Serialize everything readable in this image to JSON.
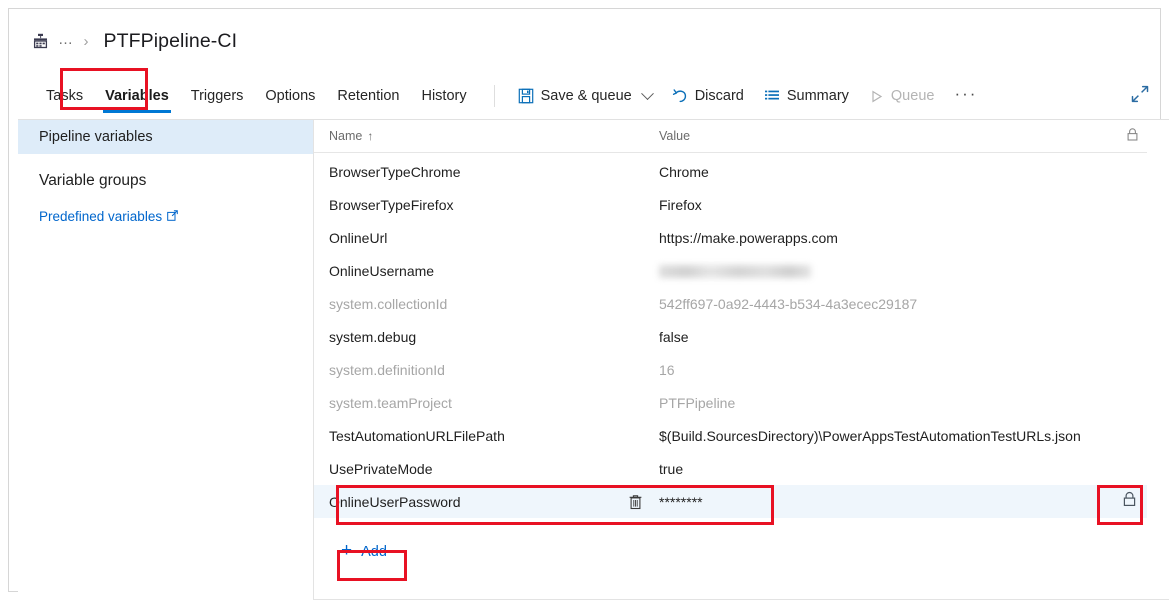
{
  "breadcrumb": {
    "pipeline_icon": "pipeline-icon",
    "ellipsis": "…",
    "separator": "›",
    "title": "PTFPipeline-CI"
  },
  "tabs": [
    {
      "label": "Tasks",
      "active": false,
      "name": "tab-tasks"
    },
    {
      "label": "Variables",
      "active": true,
      "name": "tab-variables"
    },
    {
      "label": "Triggers",
      "active": false,
      "name": "tab-triggers"
    },
    {
      "label": "Options",
      "active": false,
      "name": "tab-options"
    },
    {
      "label": "Retention",
      "active": false,
      "name": "tab-retention"
    },
    {
      "label": "History",
      "active": false,
      "name": "tab-history"
    }
  ],
  "toolbar": {
    "save_queue_label": "Save & queue",
    "discard_label": "Discard",
    "summary_label": "Summary",
    "queue_label": "Queue",
    "overflow_label": "···",
    "expand_label": "expand-icon"
  },
  "sidebar": {
    "items": [
      {
        "label": "Pipeline variables",
        "selected": true,
        "name": "sidebar-item-pipeline-variables"
      },
      {
        "label": "Variable groups",
        "selected": false,
        "name": "sidebar-item-variable-groups"
      }
    ],
    "link": {
      "label": "Predefined variables",
      "external_icon": "external-link-icon"
    }
  },
  "grid": {
    "columns": {
      "name": "Name",
      "sort_indicator": "↑",
      "value": "Value",
      "lock": "lock-icon"
    },
    "rows": [
      {
        "name": "BrowserTypeChrome",
        "value": "Chrome",
        "readonly": false,
        "selected": false,
        "secret": false
      },
      {
        "name": "BrowserTypeFirefox",
        "value": "Firefox",
        "readonly": false,
        "selected": false,
        "secret": false
      },
      {
        "name": "OnlineUrl",
        "value": "https://make.powerapps.com",
        "readonly": false,
        "selected": false,
        "secret": false
      },
      {
        "name": "OnlineUsername",
        "value": "",
        "readonly": false,
        "selected": false,
        "secret": false,
        "redacted": true
      },
      {
        "name": "system.collectionId",
        "value": "542ff697-0a92-4443-b534-4a3ecec29187",
        "readonly": true,
        "selected": false,
        "secret": false
      },
      {
        "name": "system.debug",
        "value": "false",
        "readonly": false,
        "selected": false,
        "secret": false
      },
      {
        "name": "system.definitionId",
        "value": "16",
        "readonly": true,
        "selected": false,
        "secret": false
      },
      {
        "name": "system.teamProject",
        "value": "PTFPipeline",
        "readonly": true,
        "selected": false,
        "secret": false
      },
      {
        "name": "TestAutomationURLFilePath",
        "value": "$(Build.SourcesDirectory)\\PowerAppsTestAutomationTestURLs.json",
        "readonly": false,
        "selected": false,
        "secret": false
      },
      {
        "name": "UsePrivateMode",
        "value": "true",
        "readonly": false,
        "selected": false,
        "secret": false
      },
      {
        "name": "OnlineUserPassword",
        "value": "********",
        "readonly": false,
        "selected": true,
        "secret": true
      }
    ],
    "add_button": {
      "label": "Add",
      "plus": "+"
    }
  },
  "annotations": {
    "accent_red": "#e81123",
    "accent_blue": "#0078d4",
    "selected_row_bg": "#eff6fc",
    "sidebar_selected_bg": "#deecf9"
  }
}
